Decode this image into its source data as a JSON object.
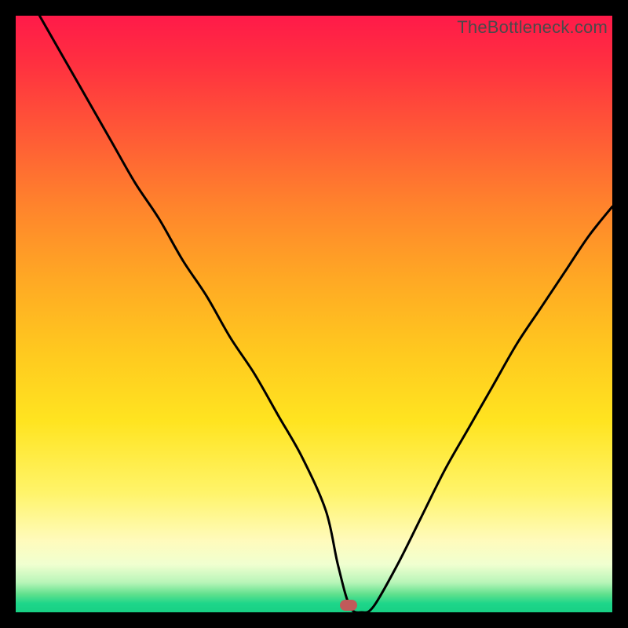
{
  "watermark": {
    "text": "TheBottleneck.com"
  },
  "marker": {
    "x_pct": 55.8,
    "y_pct": 98.8,
    "color": "#c05a5a"
  },
  "chart_data": {
    "type": "line",
    "title": "",
    "xlabel": "",
    "ylabel": "",
    "xlim": [
      0,
      100
    ],
    "ylim": [
      0,
      100
    ],
    "annotations": [
      "TheBottleneck.com"
    ],
    "x": [
      4,
      8,
      12,
      16,
      20,
      24,
      28,
      32,
      36,
      40,
      44,
      48,
      52,
      54,
      56,
      58,
      60,
      64,
      68,
      72,
      76,
      80,
      84,
      88,
      92,
      96,
      100
    ],
    "values": [
      100,
      93,
      86,
      79,
      72,
      66,
      59,
      53,
      46,
      40,
      33,
      26,
      17,
      8,
      1,
      0,
      1,
      8,
      16,
      24,
      31,
      38,
      45,
      51,
      57,
      63,
      68
    ],
    "grid": false,
    "legend": false,
    "marker_point": {
      "x": 55.8,
      "y": 1.2
    }
  }
}
